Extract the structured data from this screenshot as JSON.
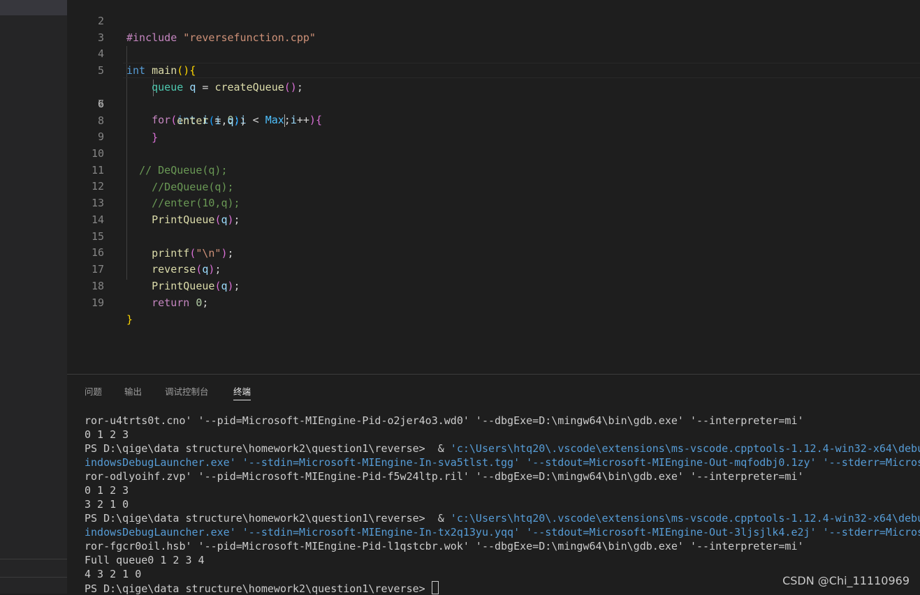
{
  "editor": {
    "line_numbers": [
      "2",
      "3",
      "4",
      "5",
      "6",
      "7",
      "8",
      "9",
      "10",
      "11",
      "12",
      "13",
      "14",
      "15",
      "16",
      "17",
      "18",
      "19"
    ],
    "include_directive": "#include",
    "include_file": "\"reversefunction.cpp\"",
    "main_kw": "int",
    "main_name": "main",
    "l5_type": "queue",
    "l5_var": "q",
    "l5_fn": "createQueue",
    "for_kw": "for",
    "for_int": "int",
    "for_i": "i",
    "for_zero": "0",
    "for_i2": "i",
    "for_max": "Max",
    "for_i3": "i",
    "enter_fn": "enter",
    "enter_i": "i",
    "enter_q": "q",
    "cmt10": "// DeQueue(q);",
    "cmt11": "//DeQueue(q);",
    "cmt12": "//enter(10,q);",
    "print1_fn": "PrintQueue",
    "print1_q": "q",
    "printf_fn": "printf",
    "printf_str": "\"\\n\"",
    "reverse_fn": "reverse",
    "reverse_q": "q",
    "print2_fn": "PrintQueue",
    "print2_q": "q",
    "return_kw": "return",
    "return_val": "0"
  },
  "panel": {
    "tabs": [
      "问题",
      "输出",
      "调试控制台",
      "终端"
    ],
    "active_tab": "终端",
    "terminal": [
      {
        "plain": "ror-u4trts0t.cno' '--pid=Microsoft-MIEngine-Pid-o2jer4o3.wd0' '--dbgExe=D:\\mingw64\\bin\\gdb.exe' '--interpreter=mi'",
        "highlight": ""
      },
      {
        "plain": "0 1 2 3",
        "highlight": ""
      },
      {
        "plain": "PS D:\\qige\\data structure\\homework2\\question1\\reverse>  & ",
        "highlight": "'c:\\Users\\htq20\\.vscode\\extensions\\ms-vscode.cpptools-1.12.4-win32-x64\\debugAdapters\\bin\\W"
      },
      {
        "plain": "",
        "highlight": "indowsDebugLauncher.exe' '--stdin=Microsoft-MIEngine-In-sva5tlst.tgg' '--stdout=Microsoft-MIEngine-Out-mqfodbj0.1zy' '--stderr=Microsoft-MIEngine-Er"
      },
      {
        "plain": "ror-odlyoihf.zvp' '--pid=Microsoft-MIEngine-Pid-f5w24ltp.ril' '--dbgExe=D:\\mingw64\\bin\\gdb.exe' '--interpreter=mi'",
        "highlight": ""
      },
      {
        "plain": "0 1 2 3",
        "highlight": ""
      },
      {
        "plain": "3 2 1 0",
        "highlight": ""
      },
      {
        "plain": "PS D:\\qige\\data structure\\homework2\\question1\\reverse>  & ",
        "highlight": "'c:\\Users\\htq20\\.vscode\\extensions\\ms-vscode.cpptools-1.12.4-win32-x64\\debugAdapters\\bin\\W"
      },
      {
        "plain": "",
        "highlight": "indowsDebugLauncher.exe' '--stdin=Microsoft-MIEngine-In-tx2q13yu.yqq' '--stdout=Microsoft-MIEngine-Out-3ljsjlk4.e2j' '--stderr=Microsoft-MIEngine-Er"
      },
      {
        "plain": "ror-fgcr0oil.hsb' '--pid=Microsoft-MIEngine-Pid-l1qstcbr.wok' '--dbgExe=D:\\mingw64\\bin\\gdb.exe' '--interpreter=mi'",
        "highlight": ""
      },
      {
        "plain": "Full queue0 1 2 3 4",
        "highlight": ""
      },
      {
        "plain": "4 3 2 1 0",
        "highlight": ""
      },
      {
        "plain": "PS D:\\qige\\data structure\\homework2\\question1\\reverse> ",
        "highlight": ""
      }
    ]
  },
  "watermark": "CSDN @Chi_11110969"
}
